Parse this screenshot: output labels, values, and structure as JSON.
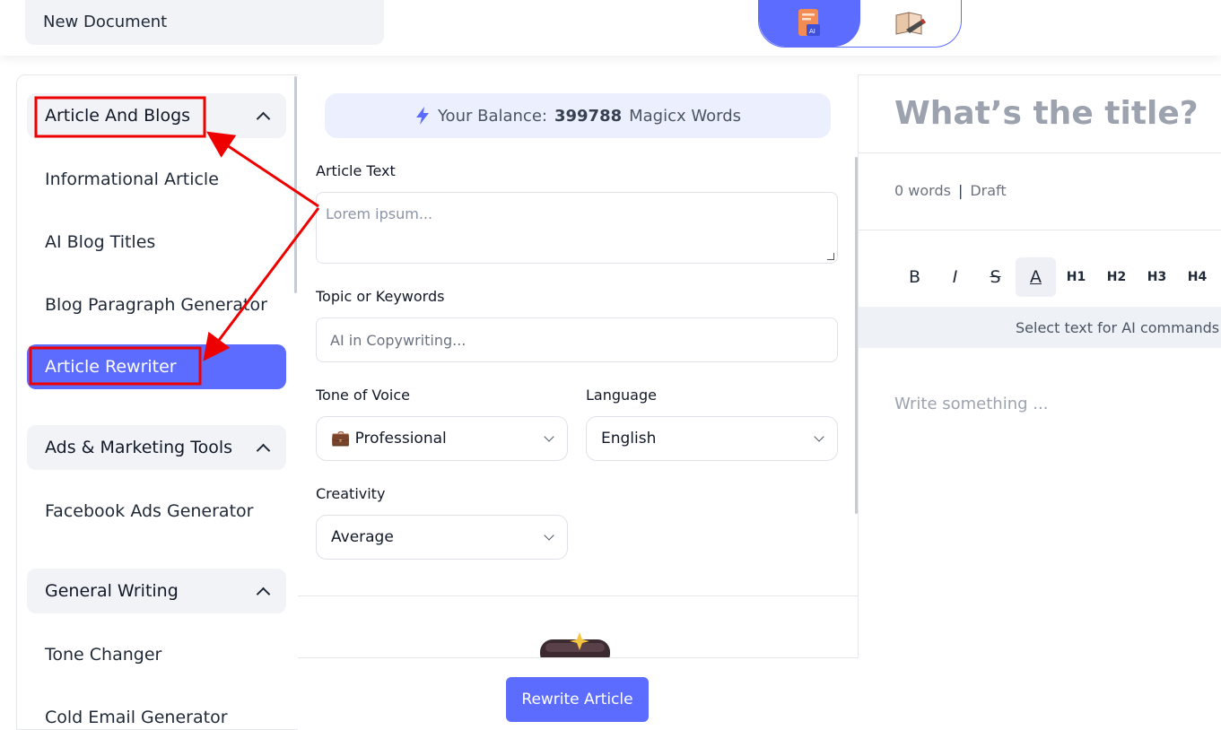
{
  "header": {
    "document_name": "New Document",
    "mode_toggle": [
      {
        "icon": "ai-document-icon",
        "active": true
      },
      {
        "icon": "book-pen-icon",
        "active": false
      }
    ]
  },
  "sidebar": {
    "categories": [
      {
        "label": "Article And Blogs",
        "items": [
          "Informational Article",
          "AI Blog Titles",
          "Blog Paragraph Generator",
          "Article Rewriter"
        ]
      },
      {
        "label": "Ads & Marketing Tools",
        "items": [
          "Facebook Ads Generator"
        ]
      },
      {
        "label": "General Writing",
        "items": [
          "Tone Changer",
          "Cold Email Generator"
        ]
      }
    ],
    "active_item": "Article Rewriter"
  },
  "form": {
    "balance_prefix": "Your Balance:",
    "balance_value": "399788",
    "balance_suffix": "Magicx Words",
    "article_text_label": "Article Text",
    "article_text_placeholder": "Lorem ipsum...",
    "topic_label": "Topic or Keywords",
    "topic_placeholder": "AI in Copywriting...",
    "tone_label": "Tone of Voice",
    "tone_value": "💼 Professional",
    "language_label": "Language",
    "language_value": "English",
    "creativity_label": "Creativity",
    "creativity_value": "Average",
    "submit_label": "Rewrite Article"
  },
  "editor": {
    "title_placeholder": "What’s the title?",
    "word_count": "0 words",
    "meta_separator": "|",
    "status": "Draft",
    "toolbar": {
      "bold": "B",
      "italic": "I",
      "strike": "S",
      "color": "A",
      "h1": "H1",
      "h2": "H2",
      "h3": "H3",
      "h4": "H4"
    },
    "ai_hint": "Select text for AI commands or",
    "body_placeholder": "Write something ..."
  },
  "colors": {
    "accent": "#5b6cff",
    "annotation": "#ee0000"
  }
}
